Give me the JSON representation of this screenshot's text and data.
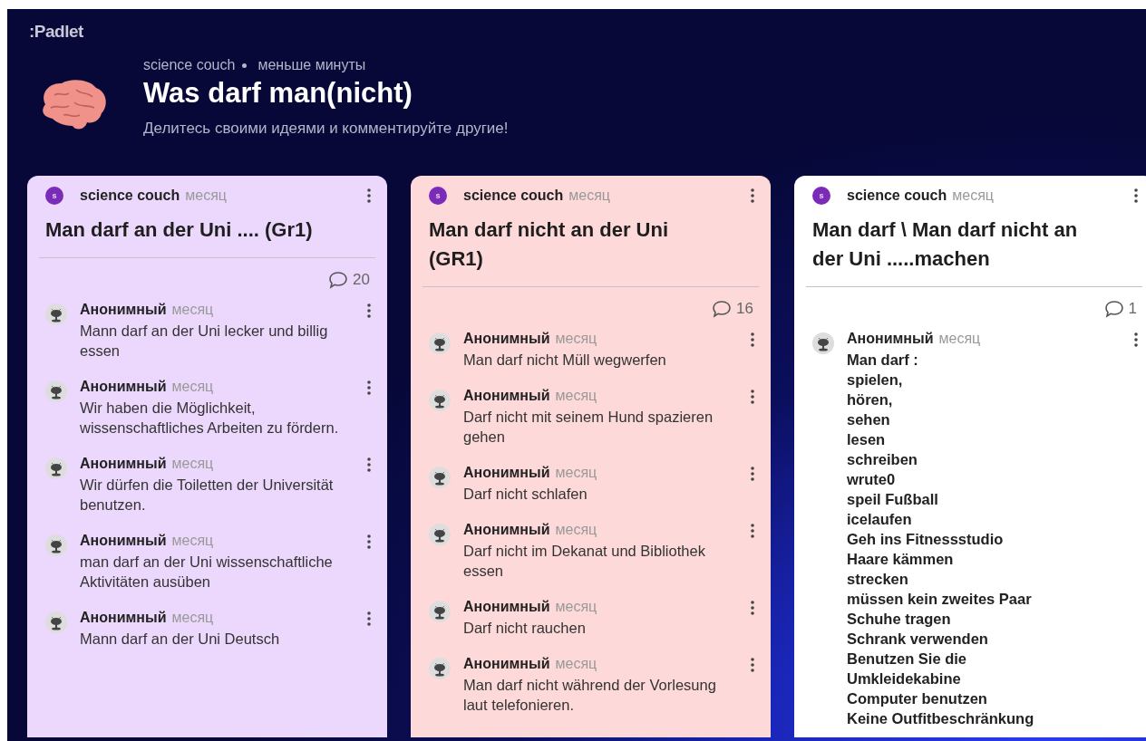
{
  "logo": ":Padlet",
  "header": {
    "author": "science couch",
    "time": "меньше минуты",
    "title": "Was darf man(nicht)",
    "subtitle": "Делитесь своими идеями и комментируйте другие!"
  },
  "columns": [
    {
      "color": "#ecd8fd",
      "avatar": "s",
      "author": "science couch",
      "time": "месяц",
      "title": "Man darf an der Uni .... (Gr1)",
      "comment_count": "20",
      "comments": [
        {
          "author": "Анонимный",
          "time": "месяц",
          "text": "Mann darf an der Uni lecker und billig essen",
          "bold": false
        },
        {
          "author": "Анонимный",
          "time": "месяц",
          "text": "Wir haben die Möglichkeit, wissenschaftliches Arbeiten zu fördern.",
          "bold": false
        },
        {
          "author": "Анонимный",
          "time": "месяц",
          "text": "Wir dürfen die Toiletten der Universität benutzen.",
          "bold": false
        },
        {
          "author": "Анонимный",
          "time": "месяц",
          "text": "man darf an der Uni wissenschaftliche Aktivitäten ausüben",
          "bold": false
        },
        {
          "author": "Анонимный",
          "time": "месяц",
          "text": "Mann darf an der Uni Deutsch",
          "bold": false
        }
      ]
    },
    {
      "color": "#fed9d9",
      "avatar": "s",
      "author": "science couch",
      "time": "месяц",
      "title": "Man darf nicht an der Uni (GR1)",
      "comment_count": "16",
      "comments": [
        {
          "author": "Анонимный",
          "time": "месяц",
          "text": "Man darf nicht Müll wegwerfen",
          "bold": false
        },
        {
          "author": "Анонимный",
          "time": "месяц",
          "text": "Darf nicht mit seinem Hund spazieren gehen",
          "bold": false
        },
        {
          "author": "Анонимный",
          "time": "месяц",
          "text": "Darf nicht schlafen",
          "bold": false
        },
        {
          "author": "Анонимный",
          "time": "месяц",
          "text": "Darf nicht im Dekanat und Bibliothek essen",
          "bold": false
        },
        {
          "author": "Анонимный",
          "time": "месяц",
          "text": "Darf nicht rauchen",
          "bold": false
        },
        {
          "author": "Анонимный",
          "time": "месяц",
          "text": "Man darf nicht während der Vorlesung laut telefonieren.",
          "bold": false
        }
      ]
    },
    {
      "color": "#ffffff",
      "avatar": "s",
      "author": "science couch",
      "time": "месяц",
      "title": "Man darf \\ Man darf nicht an der Uni .....machen",
      "comment_count": "1",
      "comments": [
        {
          "author": "Анонимный",
          "time": "месяц",
          "text": "Man darf :\nspielen,\nhören,\nsehen\nlesen\nschreiben\nwrute0\nspeil Fußball\nicelaufen\nGeh ins Fitnessstudio\nHaare kämmen\nstrecken\nmüssen kein zweites Paar\nSchuhe tragen\nSchrank verwenden\nBenutzen Sie die\nUmkleidekabine\nComputer benutzen\nKeine Outfitbeschränkung",
          "bold": true
        }
      ]
    }
  ]
}
